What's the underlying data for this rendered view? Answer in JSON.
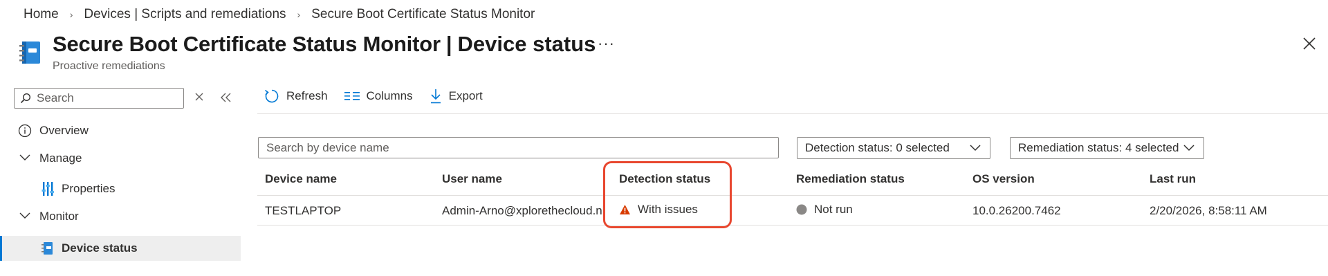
{
  "breadcrumb": {
    "items": [
      "Home",
      "Devices | Scripts and remediations"
    ],
    "current": "Secure Boot Certificate Status Monitor"
  },
  "header": {
    "title": "Secure Boot Certificate Status Monitor",
    "separator": "|",
    "blade": "Device status",
    "subtitle": "Proactive remediations",
    "more": "···"
  },
  "sidebar": {
    "search_placeholder": "Search",
    "items": [
      {
        "label": "Overview",
        "icon": "info-icon"
      },
      {
        "label": "Manage",
        "icon": "chevron-down-icon"
      },
      {
        "label": "Properties",
        "icon": "properties-icon"
      },
      {
        "label": "Monitor",
        "icon": "chevron-down-icon"
      },
      {
        "label": "Device status",
        "icon": "device-status-icon",
        "selected": true
      }
    ]
  },
  "toolbar": {
    "refresh": "Refresh",
    "columns": "Columns",
    "export": "Export"
  },
  "filters": {
    "search_placeholder": "Search by device name",
    "detection": "Detection status: 0 selected",
    "remediation": "Remediation status: 4 selected"
  },
  "table": {
    "columns": [
      "Device name",
      "User name",
      "Detection status",
      "Remediation status",
      "OS version",
      "Last run"
    ],
    "rows": [
      {
        "device": "TESTLAPTOP",
        "user": "Admin-Arno@xplorethecloud.nl",
        "detection": "With issues",
        "remediation": "Not run",
        "os": "10.0.26200.7462",
        "last_run": "2/20/2026, 8:58:11 AM"
      }
    ]
  },
  "colors": {
    "accent": "#0078d4",
    "warning": "#d83b01",
    "not_run": "#8a8886",
    "highlight": "#e8472f"
  }
}
